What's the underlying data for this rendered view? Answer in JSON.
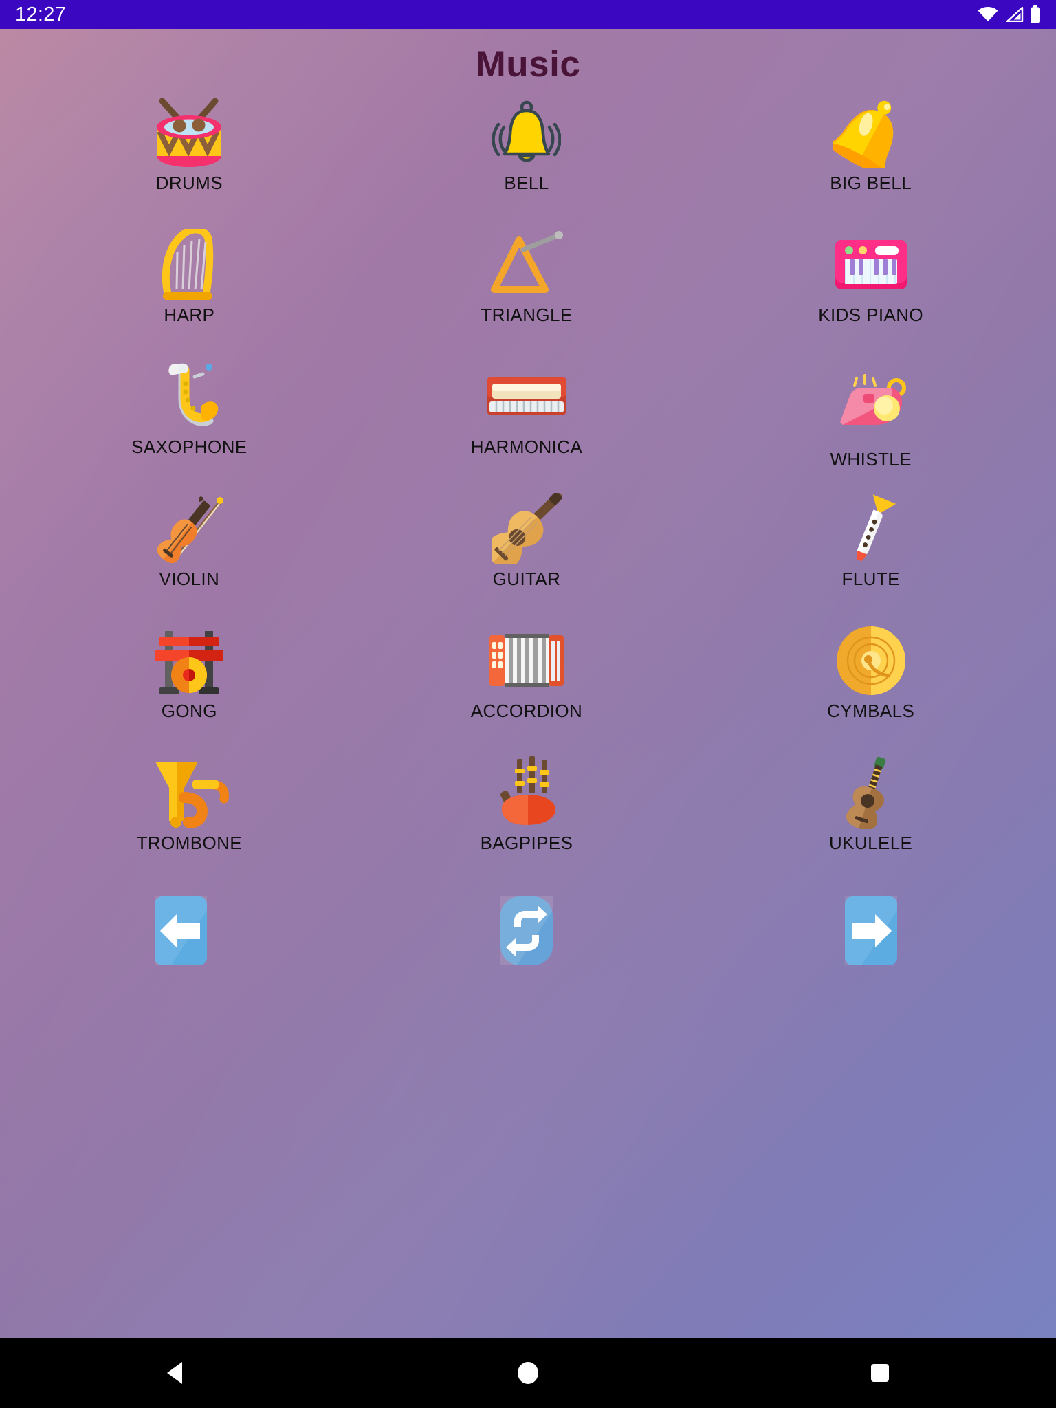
{
  "status_bar": {
    "time": "12:27",
    "background_color": "#3B07C0",
    "text_color": "#FFFFFF",
    "icons": [
      "wifi-icon",
      "cell-signal-icon",
      "battery-icon"
    ]
  },
  "app": {
    "title": "Music",
    "title_color": "#4A1439",
    "background_gradient_from": "#B8839F",
    "background_gradient_to": "#7A82C0",
    "label_color": "#111111"
  },
  "grid": {
    "columns": 3,
    "items": [
      {
        "label": "DRUMS",
        "icon": "drums-icon"
      },
      {
        "label": "BELL",
        "icon": "bell-icon"
      },
      {
        "label": "BIG BELL",
        "icon": "big-bell-icon"
      },
      {
        "label": "HARP",
        "icon": "harp-icon"
      },
      {
        "label": "TRIANGLE",
        "icon": "triangle-icon"
      },
      {
        "label": "KIDS PIANO",
        "icon": "kids-piano-icon"
      },
      {
        "label": "SAXOPHONE",
        "icon": "saxophone-icon"
      },
      {
        "label": "HARMONICA",
        "icon": "harmonica-icon"
      },
      {
        "label": "WHISTLE",
        "icon": "whistle-icon"
      },
      {
        "label": "VIOLIN",
        "icon": "violin-icon"
      },
      {
        "label": "GUITAR",
        "icon": "guitar-icon"
      },
      {
        "label": "FLUTE",
        "icon": "flute-icon"
      },
      {
        "label": "GONG",
        "icon": "gong-icon"
      },
      {
        "label": "ACCORDION",
        "icon": "accordion-icon"
      },
      {
        "label": "CYMBALS",
        "icon": "cymbals-icon"
      },
      {
        "label": "TROMBONE",
        "icon": "trombone-icon"
      },
      {
        "label": "BAGPIPES",
        "icon": "bagpipes-icon"
      },
      {
        "label": "UKULELE",
        "icon": "ukulele-icon"
      }
    ]
  },
  "nav": {
    "button_color": "#5CACE2",
    "buttons": [
      {
        "name": "previous-page-button",
        "icon": "arrow-left-icon"
      },
      {
        "name": "shuffle-button",
        "icon": "repeat-icon"
      },
      {
        "name": "next-page-button",
        "icon": "arrow-right-icon"
      }
    ]
  },
  "system_nav": {
    "background_color": "#000000",
    "buttons": [
      {
        "name": "android-back-button",
        "icon": "back-triangle-icon"
      },
      {
        "name": "android-home-button",
        "icon": "home-circle-icon"
      },
      {
        "name": "android-recents-button",
        "icon": "recents-square-icon"
      }
    ]
  }
}
